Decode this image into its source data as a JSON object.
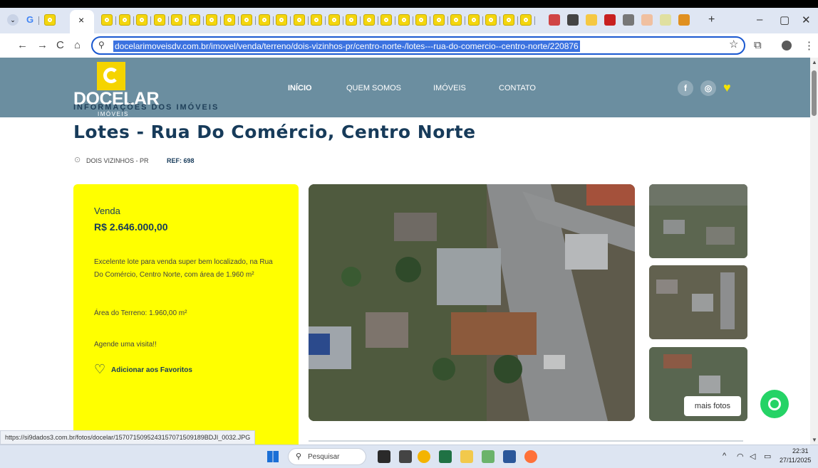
{
  "browser": {
    "url": "docelarimoveisdv.com.br/imovel/venda/terreno/dois-vizinhos-pr/centro-norte-/lotes---rua-do-comercio--centro-norte/220876",
    "status_url": "https://si9dados3.com.br/fotos/docelar/1570715095243157071509189BDJI_0032.JPG",
    "tab_close": "×",
    "new_tab": "+",
    "minimize": "–",
    "restore": "▢",
    "close": "✕",
    "back": "←",
    "forward": "→",
    "reload": "C",
    "home": "⌂",
    "bookmark": "☆",
    "menu": "⋮"
  },
  "site": {
    "logo_text": "DOCELAR",
    "logo_sub": "IMÓVEIS",
    "nav": [
      "INÍCIO",
      "QUEM SOMOS",
      "IMÓVEIS",
      "CONTATO"
    ],
    "social": {
      "facebook": "f",
      "instagram": "◎"
    },
    "section_kicker": "INFORMAÇÕES DOS IMÓVEIS",
    "brand_color": "#f5d400",
    "header_color": "#6b8ea0",
    "title_color": "#173b5a"
  },
  "property": {
    "title": "Lotes - Rua Do Comércio, Centro Norte",
    "location": "DOIS VIZINHOS - PR",
    "ref": "REF: 698",
    "deal_type": "Venda",
    "price": "R$ 2.646.000,00",
    "description": "Excelente lote para venda super bem localizado, na Rua Do Comércio, Centro Norte, com área de 1.960 m²",
    "area": "Área do Terreno: 1.960,00 m²",
    "visit": "Agende uma visita!!",
    "favorite_label": "Adicionar aos Favoritos",
    "more_photos": "mais fotos"
  },
  "taskbar": {
    "search_placeholder": "Pesquisar",
    "time": "22:31",
    "date": "27/11/2025"
  }
}
